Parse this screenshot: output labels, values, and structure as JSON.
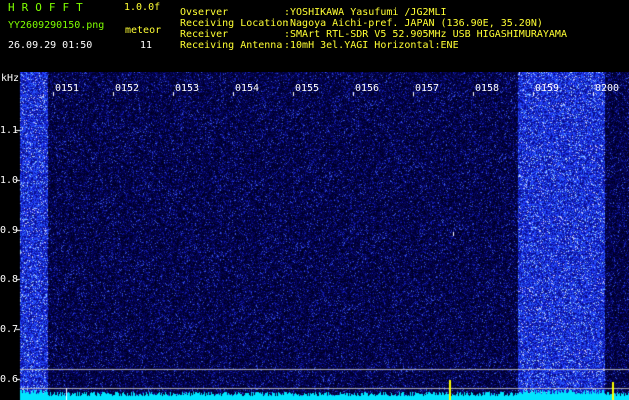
{
  "header": {
    "logo": "HROFFT",
    "version": "1.0.0f",
    "filename": "YY2609290150.png",
    "mode": "meteor",
    "datetime": "26.09.29 01:50",
    "count": "11",
    "info": [
      {
        "label": "Ovserver",
        "value": ":YOSHIKAWA Yasufumi /JG2MLI"
      },
      {
        "label": "Receiving Location",
        "value": ":Nagoya Aichi-pref. JAPAN (136.90E, 35.20N)"
      },
      {
        "label": "Receiver",
        "value": ":SMArt RTL-SDR V5 52.905MHz USB HIGASHIMURAYAMA"
      },
      {
        "label": "Receiving Antenna",
        "value": ":10mH 3el.YAGI Horizontal:ENE"
      }
    ]
  },
  "spectrogram": {
    "unit_label": "kHz",
    "freq_labels": [
      "1.1",
      "1.0",
      "0.9",
      "0.8",
      "0.7",
      "0.6"
    ],
    "time_labels": [
      "0151",
      "0152",
      "0153",
      "0154",
      "0155",
      "0156",
      "0157",
      "0158",
      "0159",
      "0200"
    ],
    "colors": {
      "background": "#000000",
      "noise": "#0b0b5a",
      "noise_dense": "#2b3cff",
      "baseline": "#00ffff",
      "echo": "#ffff00"
    }
  }
}
